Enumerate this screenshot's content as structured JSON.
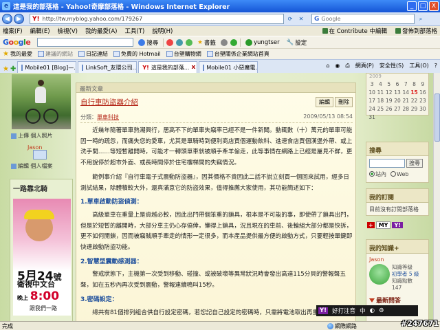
{
  "window": {
    "title": "這是我的部落格 - Yahoo!奇摩部落格 - Windows Internet Explorer",
    "buttons": [
      "_",
      "□",
      "X"
    ]
  },
  "address": {
    "url": "http://tw.myblog.yahoo.com/179267",
    "search_placeholder": "Google"
  },
  "menu": {
    "items": [
      "檔案(F)",
      "編輯(E)",
      "檢視(V)",
      "我的最愛(A)",
      "工具(T)",
      "說明(H)"
    ],
    "contribute_edit": "在 Contribute 中編輯",
    "post_to_blog": "發佈到部落格"
  },
  "google_toolbar": {
    "logo_parts": [
      "G",
      "o",
      "o",
      "g",
      "l",
      "e"
    ],
    "search_label": "搜尋",
    "bookmarks_label": "書籤",
    "user": "yungtser",
    "settings_label": "設定"
  },
  "favorites": {
    "label": "我的最愛",
    "links": [
      "建議的網站",
      "日記連結",
      "免費的 Hotmail",
      "台塑購物網",
      "台塑關係企業網站首頁"
    ]
  },
  "tabs": {
    "items": [
      "Mobile01 [Blog]—...",
      "LinkSoft_友環公司...",
      "這是我的部落...",
      "Mobile01 小惡魔電..."
    ],
    "active_index": 2,
    "controls": [
      "網頁(P)",
      "安全性(S)",
      "工具(O)"
    ]
  },
  "left": {
    "upload_photo": "上傳 個人照片",
    "username": "Jason",
    "edit_profile": "編輯 個人檔案",
    "section_title": "一路靠北騎",
    "ad": {
      "date_num": "5月24",
      "date_suffix": "號",
      "title": "衛視中文台",
      "time_prefix": "晚上",
      "time": "8:00",
      "cta": "跟我們一路"
    }
  },
  "post": {
    "section": "最新文章",
    "title": "自行車防盜器介紹",
    "edit": "編輯",
    "delete": "刪除",
    "category_label": "分類：",
    "category": "單車科技",
    "timestamp": "2009/05/13 08:54",
    "p1": "近幾年隨著單車熱潮興行，居高不下的單車失竊率已經不是一件新聞。動輒數（十）萬元的單車可能因一時的疏忽，而痛失您的愛車，尤其是單騎時到便利商店買個運動飲料、進速食店買個漢堡外帶、或上洗手間……等短暫離開時，可能才一轉頭單車就被順手牽羊偷走，此等事情在網路上已經是屢見不鮮，更不用說停於超市外面、或長時間停於住宅樓梯間的失竊情況。",
    "p2": "範例事介紹『自行車電子式震動防盜器』，因其價格不貴因此二話不說立刻買一個回來試用，經多日測試結果，除體積較大外，還真滿意它的防盜效果，值得推薦大家使用，其功能簡述如下：",
    "h1": "1.單車啟動防盜偵測：",
    "p3": "高級單車在重量上是資越必較，因此出門帶個笨重的鎖具，根本是不可能的事，即使帶了鎖具出門，但是於短暫的離開時，大部分車主仍心存僥倖，懶得上鎖具，況且現在的車前、後輪組大部分都是快拆，更不如何開鎖，因而被竊賊順手牽走的情形一定很多，而本產品提供最方便的啟動方式，只要輕按單鍵即快速啟動防盜功能。",
    "h2": "2.智慧型震動感測器：",
    "p4": "警戒狀態下，主機第一次受到移動、碰撞、或被破壞等異常狀況時會發出高達115分貝的警報聲五聲，如在五秒內再次受到震動，警報連續鳴叫15秒。",
    "h3": "3.密碼設定：",
    "p5": "總共有81個排列組合供自行設定密碼，若您記自己設定的密碼時，只需將電池取出再重新"
  },
  "right": {
    "calendar": {
      "year": "2009",
      "cells": [
        "3",
        "4",
        "5",
        "6",
        "7",
        "8",
        "9",
        "10",
        "11",
        "12",
        "13",
        "14",
        "15",
        "16",
        "17",
        "18",
        "19",
        "20",
        "21",
        "22",
        "23",
        "24",
        "25",
        "26",
        "27",
        "28",
        "29",
        "30",
        "31"
      ],
      "today": "15"
    },
    "search": {
      "title": "搜尋",
      "button": "搜尋",
      "option_site": "站內",
      "option_web": "Web"
    },
    "subscriptions": {
      "title": "我的訂閱",
      "empty": "目前沒有訂閱部落格"
    },
    "myyahoo": {
      "plus": "+",
      "my": "MY",
      "y": "Y!"
    },
    "knowledge": {
      "title": "我的知識+",
      "user": "Jason",
      "rank_label": "知識等級",
      "rank": "初學者 5 級",
      "points_label": "知識點數",
      "points": "147",
      "hot_title": "最新問答"
    }
  },
  "status": {
    "left": "完成",
    "zone": "網際網路"
  },
  "ime": {
    "y": "Y!",
    "label": "好打注音",
    "mode": "中"
  },
  "watermark": "#247671"
}
